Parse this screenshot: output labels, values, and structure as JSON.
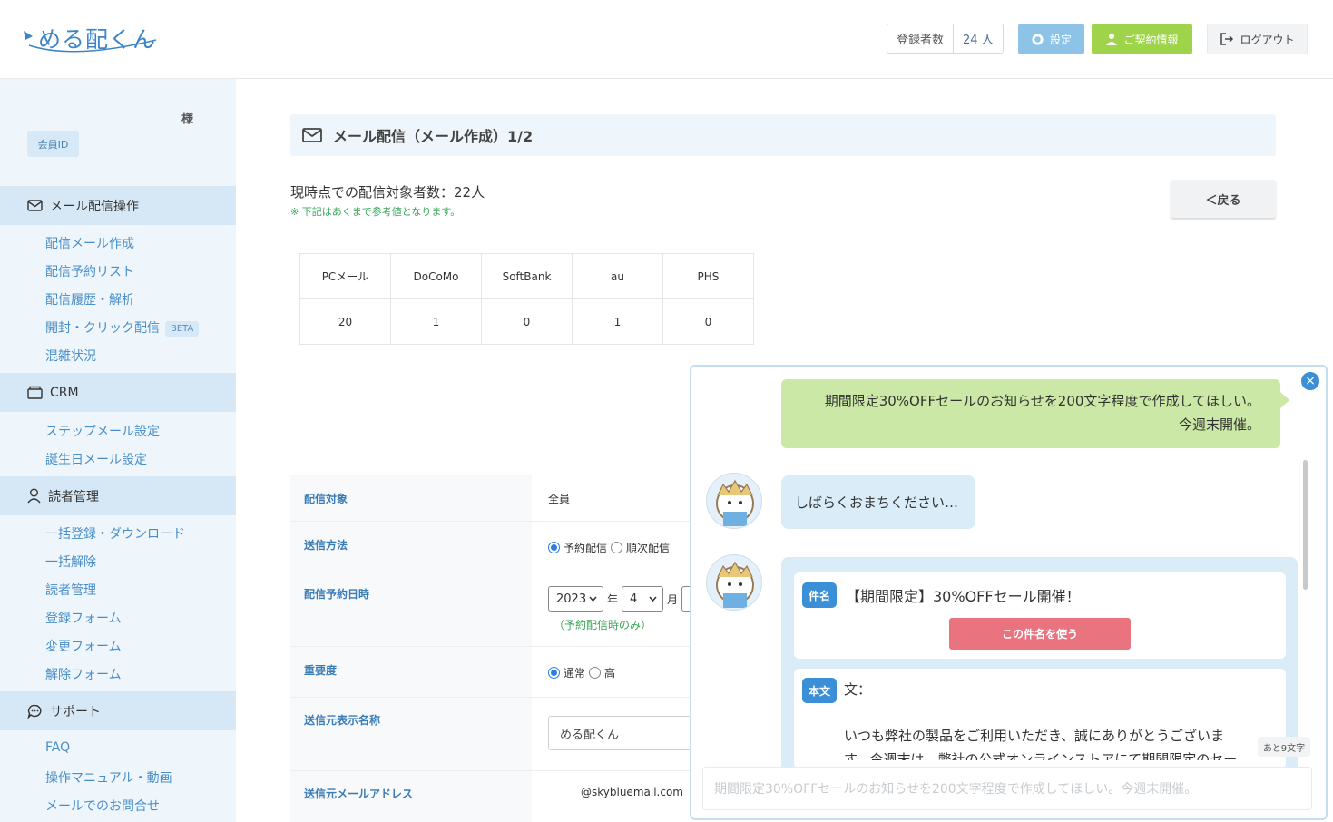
{
  "header": {
    "logo_text": "める配くん",
    "registrants_label": "登録者数",
    "registrants_count": "24 人",
    "settings_label": "設定",
    "contract_label": "ご契約情報",
    "logout_label": "ログアウト"
  },
  "sidebar": {
    "honorific": "様",
    "member_id_label": "会員ID",
    "sections": [
      {
        "title": "メール配信操作",
        "icon": "mail-icon",
        "items": [
          "配信メール作成",
          "配信予約リスト",
          "配信履歴・解析",
          "開封・クリック配信",
          "混雑状況"
        ]
      },
      {
        "title": "CRM",
        "icon": "crm-icon",
        "items": [
          "ステップメール設定",
          "誕生日メール設定"
        ]
      },
      {
        "title": "読者管理",
        "icon": "user-icon",
        "items": [
          "一括登録・ダウンロード",
          "一括解除",
          "読者管理",
          "登録フォーム",
          "変更フォーム",
          "解除フォーム"
        ]
      },
      {
        "title": "サポート",
        "icon": "chat-icon",
        "items": [
          "FAQ",
          "操作マニュアル・動画",
          "メールでのお問合せ"
        ]
      }
    ],
    "beta_badge": "BETA"
  },
  "main": {
    "page_title": "メール配信（メール作成）1/2",
    "target_count": "現時点での配信対象者数：22人",
    "note": "※ 下記はあくまで参考値となります。",
    "back_label": "＜戻る",
    "carrier_headers": [
      "PCメール",
      "DoCoMo",
      "SoftBank",
      "au",
      "PHS"
    ],
    "carrier_values": [
      "20",
      "1",
      "0",
      "1",
      "0"
    ],
    "form": {
      "target_label": "配信対象",
      "target_value": "全員",
      "method_label": "送信方法",
      "method_option1": "予約配信",
      "method_option2": "順次配信",
      "schedule_label": "配信予約日時",
      "year_value": "2023",
      "year_unit": "年",
      "month_value": "4",
      "month_unit": "月",
      "schedule_note": "（予約配信時のみ）",
      "priority_label": "重要度",
      "priority_option1": "通常",
      "priority_option2": "高",
      "sender_name_label": "送信元表示名称",
      "sender_name_value": "める配くん",
      "sender_email_label": "送信元メールアドレス",
      "sender_email_value": "@skybluemail.com"
    }
  },
  "chat": {
    "user_message_line1": "期間限定30%OFFセールのお知らせを200文字程度で作成してほしい。",
    "user_message_line2": "今週末開催。",
    "wait_message": "しばらくおまちください…",
    "subject_tag": "件名",
    "subject_text": "【期間限定】30%OFFセール開催！",
    "use_subject_button": "この件名を使う",
    "body_tag": "本文",
    "body_heading": "文：",
    "body_line1": "いつも弊社の製品をご利用いただき、誠にありがとうございま",
    "body_line2": "す。今週末は、弊社の公式オンラインストアにて期間限定のセー",
    "remaining_chars": "あと9文字",
    "input_text": "期間限定30%OFFセールのお知らせを200文字程度で作成してほしい。今週末開催。"
  }
}
